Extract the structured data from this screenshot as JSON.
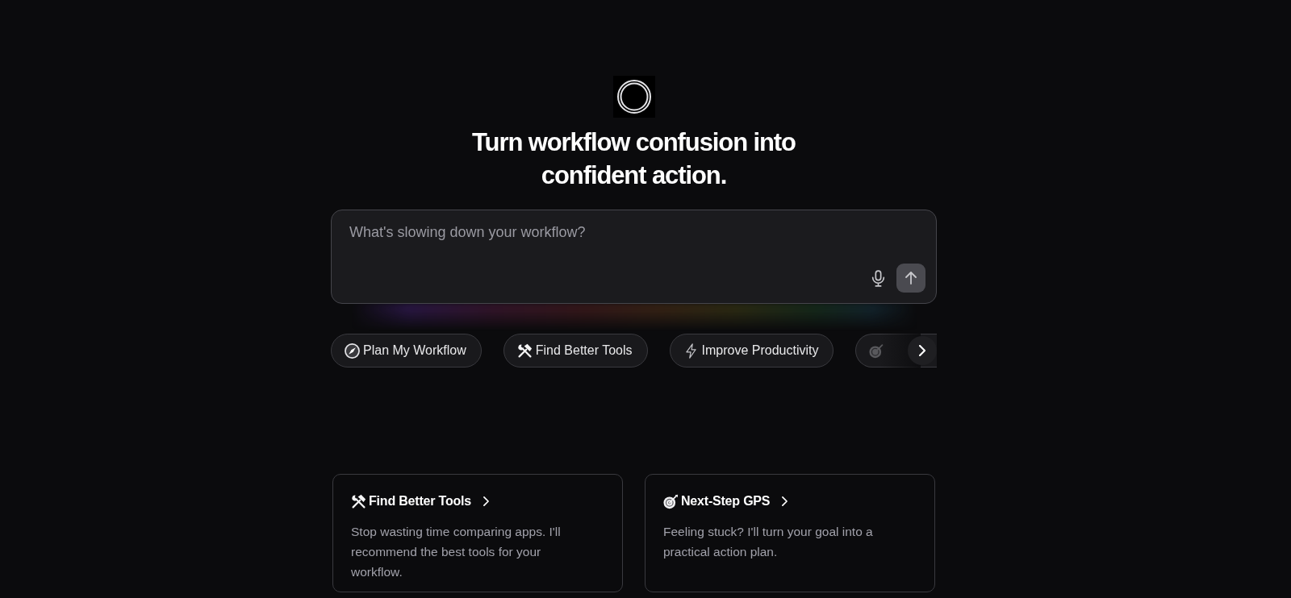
{
  "headline": "Turn workflow confusion into confident action.",
  "prompt": {
    "placeholder": "What's slowing down your workflow?"
  },
  "suggestions": [
    {
      "label": "Plan My Workflow"
    },
    {
      "label": "Find Better Tools"
    },
    {
      "label": "Improve Productivity"
    }
  ],
  "cards": [
    {
      "title": "Find Better Tools",
      "description": "Stop wasting time comparing apps. I'll recommend the best tools for your workflow."
    },
    {
      "title": "Next-Step GPS",
      "description": "Feeling stuck? I'll turn your goal into a practical action plan."
    }
  ]
}
